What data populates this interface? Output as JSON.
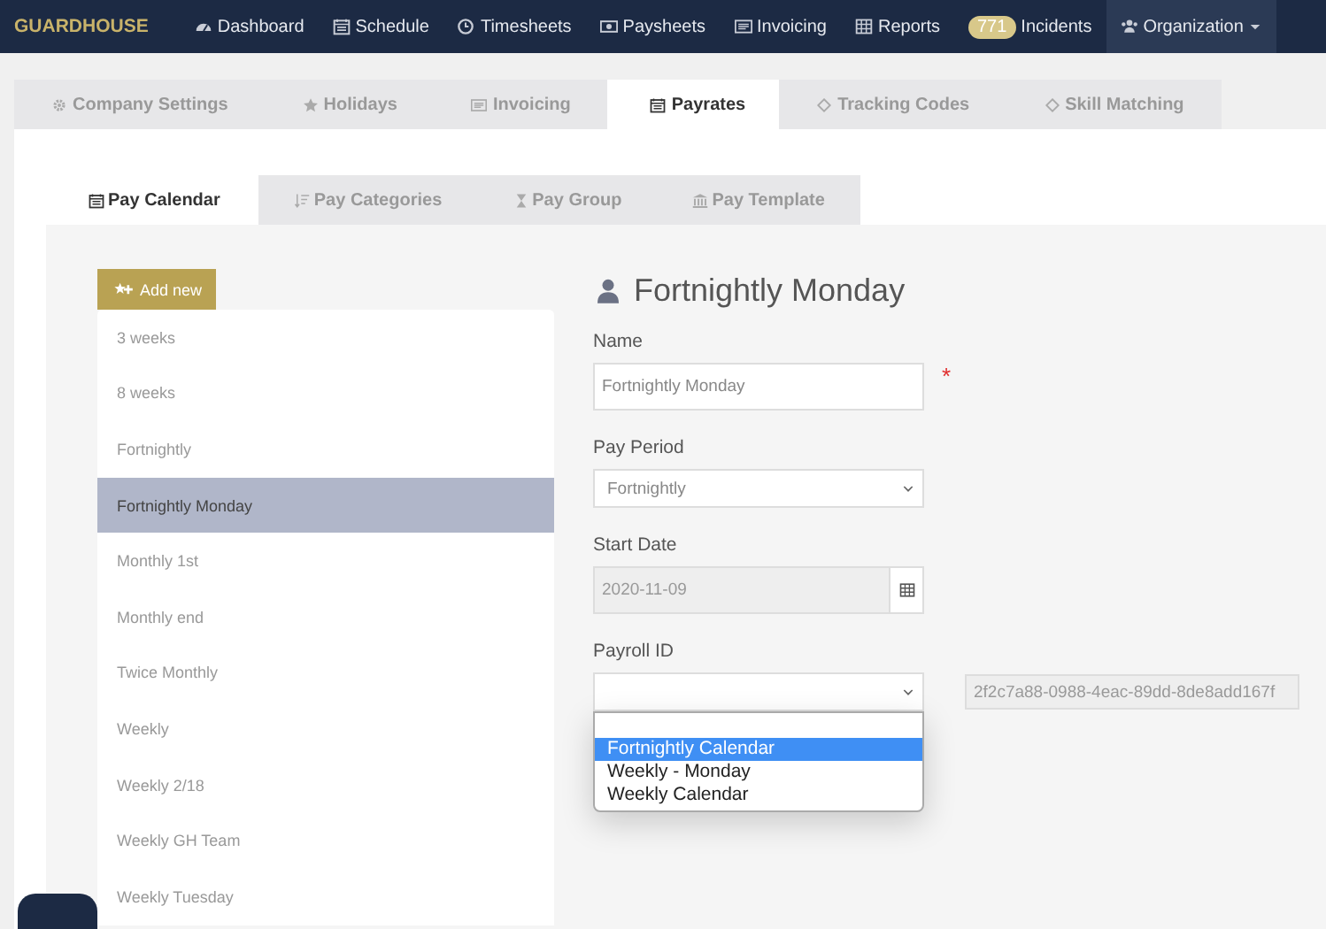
{
  "navbar": {
    "logo": "GUARDHOUSE",
    "items": [
      {
        "label": "Dashboard",
        "selected": false
      },
      {
        "label": "Schedule",
        "selected": false
      },
      {
        "label": "Timesheets",
        "selected": false
      },
      {
        "label": "Paysheets",
        "selected": false
      },
      {
        "label": "Invoicing",
        "selected": false
      },
      {
        "label": "Reports",
        "selected": false
      },
      {
        "label": "Incidents",
        "badge": "771",
        "selected": false
      },
      {
        "label": "Organization",
        "selected": true
      }
    ]
  },
  "tabs": [
    {
      "label": "Company Settings",
      "selected": false
    },
    {
      "label": "Holidays",
      "selected": false
    },
    {
      "label": "Invoicing",
      "selected": false
    },
    {
      "label": "Payrates",
      "selected": true
    },
    {
      "label": "Tracking Codes",
      "selected": false
    },
    {
      "label": "Skill Matching",
      "selected": false
    }
  ],
  "subtabs": [
    {
      "label": "Pay Calendar",
      "selected": true
    },
    {
      "label": "Pay Categories",
      "selected": false
    },
    {
      "label": "Pay Group",
      "selected": false
    },
    {
      "label": "Pay Template",
      "selected": false
    }
  ],
  "add_button": "Add new",
  "calendars": [
    {
      "label": "3 weeks",
      "selected": false
    },
    {
      "label": "8 weeks",
      "selected": false
    },
    {
      "label": "Fortnightly",
      "selected": false
    },
    {
      "label": "Fortnightly Monday",
      "selected": true
    },
    {
      "label": "Monthly 1st",
      "selected": false
    },
    {
      "label": "Monthly end",
      "selected": false
    },
    {
      "label": "Twice Monthly",
      "selected": false
    },
    {
      "label": "Weekly",
      "selected": false
    },
    {
      "label": "Weekly 2/18",
      "selected": false
    },
    {
      "label": "Weekly GH Team",
      "selected": false
    },
    {
      "label": "Weekly Tuesday",
      "selected": false
    }
  ],
  "form": {
    "title": "Fortnightly Monday",
    "name": {
      "label": "Name",
      "value": "Fortnightly Monday",
      "required_mark": "*"
    },
    "pay_period": {
      "label": "Pay Period",
      "value": "Fortnightly"
    },
    "start_date": {
      "label": "Start Date",
      "value": "2020-11-09"
    },
    "payroll_id": {
      "label": "Payroll ID",
      "id_value": "2f2c7a88-0988-4eac-89dd-8de8add167f",
      "options": [
        {
          "label": "Fortnightly Calendar",
          "selected": true
        },
        {
          "label": "Weekly - Monday",
          "selected": false
        },
        {
          "label": "Weekly Calendar",
          "selected": false
        }
      ]
    }
  }
}
